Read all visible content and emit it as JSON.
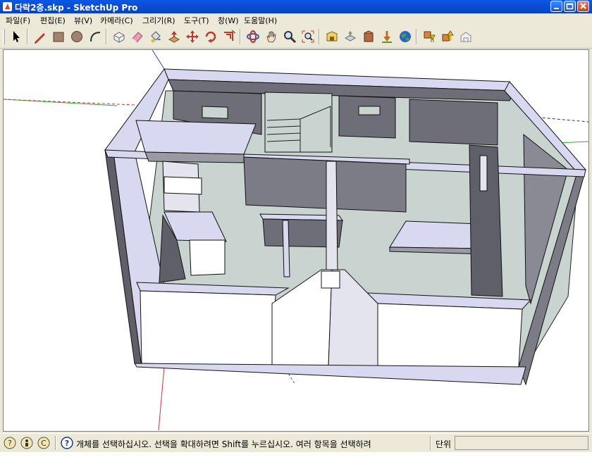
{
  "window": {
    "title": "다락2층.skp - SketchUp Pro",
    "buttons": [
      "minimize",
      "maximize",
      "close"
    ]
  },
  "menu": {
    "items": [
      "파일(F)",
      "편집(E)",
      "뷰(V)",
      "카메라(C)",
      "그리기(R)",
      "도구(T)",
      "창(W)",
      "도움말(H)"
    ]
  },
  "toolbar": {
    "tools": [
      "select-icon",
      "pencil-icon",
      "rectangle-icon",
      "circle-icon",
      "arc-icon",
      "make-component-icon",
      "eraser-icon",
      "paint-bucket-icon",
      "push-pull-icon",
      "move-icon",
      "rotate-icon",
      "offset-icon",
      "orbit-icon",
      "pan-icon",
      "zoom-icon",
      "zoom-extents-icon",
      "warehouse-icon",
      "share-model-icon",
      "get-models-icon",
      "place-model-icon",
      "google-earth-icon",
      "component-download-icon",
      "component-upload-icon",
      "extension-icon"
    ]
  },
  "status": {
    "message": "개체를 선택하십시오. 선택을 확대하려면 Shift를 누르십시오. 여러 항목을 선택하려",
    "unit_label": "단위",
    "icons": [
      "geo-location-icon",
      "credits-icon",
      "copyright-icon",
      "help-icon"
    ]
  },
  "colors": {
    "titlebar": "#0b4ed2",
    "chrome": "#ece9d8",
    "wall_face": "#7c7c86",
    "wall_top": "#d8d8f0",
    "floor": "#c9d3cf",
    "axis_red": "#d23232",
    "axis_green": "#2fa82f",
    "axis_blue": "#3a3ad8"
  }
}
